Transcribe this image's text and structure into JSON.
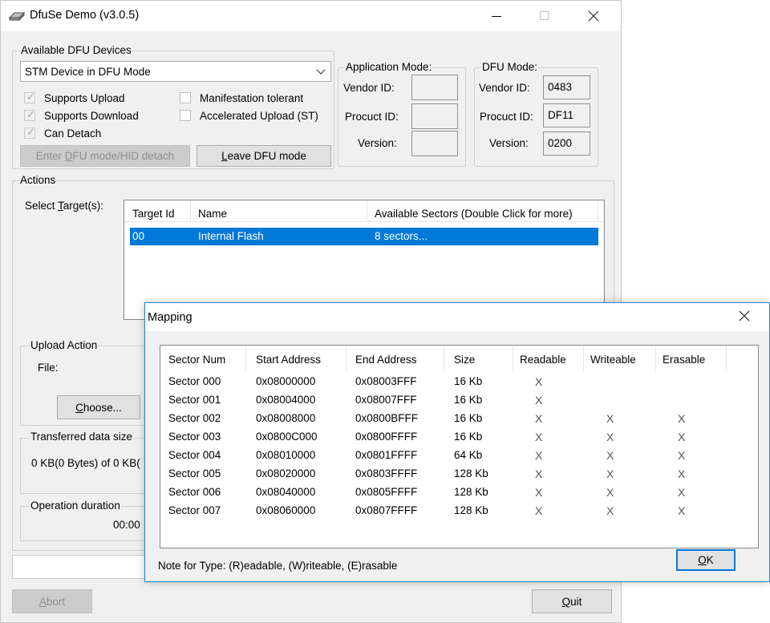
{
  "main_window": {
    "title": "DfuSe Demo (v3.0.5)",
    "controls": {
      "minimize": "—",
      "maximize": "□",
      "close": "✕"
    }
  },
  "dfu_devices": {
    "group_label": "Available DFU Devices",
    "selected_device": "STM Device in DFU Mode",
    "checks": [
      {
        "label": "Supports Upload",
        "checked": true
      },
      {
        "label": "Supports Download",
        "checked": true
      },
      {
        "label": "Can Detach",
        "checked": true
      }
    ],
    "checks_right": [
      {
        "label": "Manifestation tolerant",
        "checked": false
      },
      {
        "label": "Accelerated Upload (ST)",
        "checked": false
      }
    ],
    "enter_dfu_btn": {
      "pre": "Enter ",
      "u": "D",
      "post": "FU mode/HID detach"
    },
    "leave_dfu_btn": {
      "pre": "",
      "u": "L",
      "post": "eave DFU mode"
    }
  },
  "app_mode": {
    "label": "Application Mode:",
    "vendor_label": "Vendor ID:",
    "product_label": "Procuct ID:",
    "version_label": "Version:",
    "vendor": "",
    "product": "",
    "version": ""
  },
  "dfu_mode": {
    "label": "DFU Mode:",
    "vendor_label": "Vendor ID:",
    "product_label": "Procuct ID:",
    "version_label": "Version:",
    "vendor": "0483",
    "product": "DF11",
    "version": "0200"
  },
  "actions": {
    "group_label": "Actions",
    "select_target": {
      "pre": "Select ",
      "u": "T",
      "post": "arget(s):"
    },
    "columns": [
      "Target Id",
      "Name",
      "Available Sectors (Double Click for more)"
    ],
    "targets": [
      {
        "id": "00",
        "name": "Internal Flash",
        "sectors": "8 sectors..."
      }
    ],
    "upload_label": "Upload Action",
    "file_label": "File:",
    "choose_btn": {
      "pre": "",
      "u": "C",
      "post": "hoose..."
    },
    "transferred_label": "Transferred data size",
    "transferred_value": "0 KB(0 Bytes) of 0 KB(",
    "duration_label": "Operation duration",
    "duration_value": "00:00"
  },
  "bottom": {
    "abort_btn": {
      "pre": "",
      "u": "A",
      "post": "bort"
    },
    "quit_btn": {
      "pre": "",
      "u": "Q",
      "post": "uit"
    }
  },
  "mapping": {
    "title": "Mapping",
    "columns": [
      "Sector Num",
      "Start Address",
      "End Address",
      "Size",
      "Readable",
      "Writeable",
      "Erasable"
    ],
    "rows": [
      {
        "sector": "Sector 000",
        "start": "0x08000000",
        "end": "0x08003FFF",
        "size": "16 Kb",
        "r": "X",
        "w": "",
        "e": ""
      },
      {
        "sector": "Sector 001",
        "start": "0x08004000",
        "end": "0x08007FFF",
        "size": "16 Kb",
        "r": "X",
        "w": "",
        "e": ""
      },
      {
        "sector": "Sector 002",
        "start": "0x08008000",
        "end": "0x0800BFFF",
        "size": "16 Kb",
        "r": "X",
        "w": "X",
        "e": "X"
      },
      {
        "sector": "Sector 003",
        "start": "0x0800C000",
        "end": "0x0800FFFF",
        "size": "16 Kb",
        "r": "X",
        "w": "X",
        "e": "X"
      },
      {
        "sector": "Sector 004",
        "start": "0x08010000",
        "end": "0x0801FFFF",
        "size": "64 Kb",
        "r": "X",
        "w": "X",
        "e": "X"
      },
      {
        "sector": "Sector 005",
        "start": "0x08020000",
        "end": "0x0803FFFF",
        "size": "128 Kb",
        "r": "X",
        "w": "X",
        "e": "X"
      },
      {
        "sector": "Sector 006",
        "start": "0x08040000",
        "end": "0x0805FFFF",
        "size": "128 Kb",
        "r": "X",
        "w": "X",
        "e": "X"
      },
      {
        "sector": "Sector 007",
        "start": "0x08060000",
        "end": "0x0807FFFF",
        "size": "128 Kb",
        "r": "X",
        "w": "X",
        "e": "X"
      }
    ],
    "note": "Note for Type: (R)eadable, (W)riteable, (E)rasable",
    "ok_btn": {
      "pre": "",
      "u": "O",
      "post": "K"
    }
  }
}
